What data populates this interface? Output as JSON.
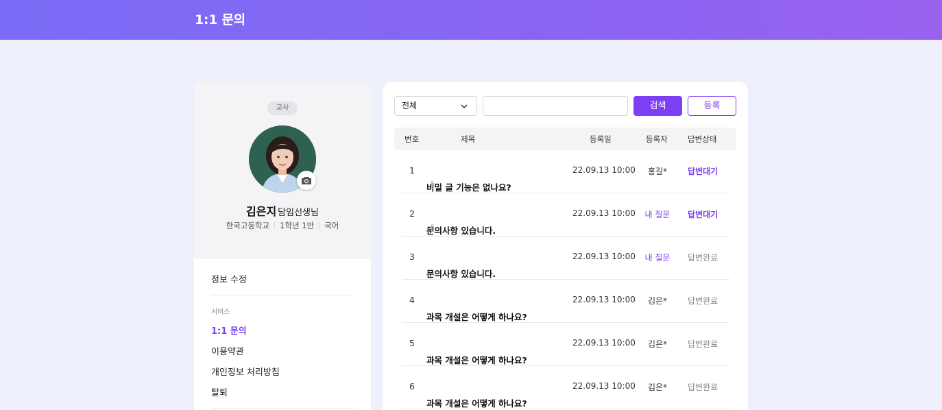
{
  "header": {
    "title": "1:1 문의"
  },
  "profile": {
    "role_badge": "교사",
    "name": "김은지",
    "name_suffix": "담임선생님",
    "school": "한국고등학교",
    "class": "1학년 1반",
    "subject": "국어"
  },
  "menu": {
    "edit_label": "정보 수정",
    "section_label": "서비스",
    "items": [
      {
        "label": "1:1 문의",
        "active": true
      },
      {
        "label": "이용약관",
        "active": false
      },
      {
        "label": "개인정보 처리방침",
        "active": false
      },
      {
        "label": "탈퇴",
        "active": false
      }
    ]
  },
  "toolbar": {
    "filter_value": "전체",
    "search_placeholder": "",
    "search_label": "검색",
    "register_label": "등록"
  },
  "table": {
    "columns": [
      "번호",
      "제목",
      "등록일",
      "등록자",
      "답변상태"
    ],
    "rows": [
      {
        "no": "1",
        "title": "비밀 글 기능은 없나요?",
        "attachment": true,
        "date": "22.09.13 10:00",
        "author": "홍길*",
        "author_mine": false,
        "status": "답변대기",
        "status_pending": true
      },
      {
        "no": "2",
        "title": "문의사항 있습니다.",
        "attachment": true,
        "date": "22.09.13 10:00",
        "author": "내 질문",
        "author_mine": true,
        "status": "답변대기",
        "status_pending": true
      },
      {
        "no": "3",
        "title": "문의사항 있습니다.",
        "attachment": false,
        "date": "22.09.13 10:00",
        "author": "내 질문",
        "author_mine": true,
        "status": "답변완료",
        "status_pending": false
      },
      {
        "no": "4",
        "title": "과목 개설은 어떻게 하나요?",
        "attachment": false,
        "date": "22.09.13 10:00",
        "author": "김은*",
        "author_mine": false,
        "status": "답변완료",
        "status_pending": false
      },
      {
        "no": "5",
        "title": "과목 개설은 어떻게 하나요?",
        "attachment": false,
        "date": "22.09.13 10:00",
        "author": "김은*",
        "author_mine": false,
        "status": "답변완료",
        "status_pending": false
      },
      {
        "no": "6",
        "title": "과목 개설은 어떻게 하나요?",
        "attachment": false,
        "date": "22.09.13 10:00",
        "author": "김은*",
        "author_mine": false,
        "status": "답변완료",
        "status_pending": false
      }
    ]
  },
  "colors": {
    "accent": "#7c3ff3",
    "header_start": "#7a6cf6",
    "header_end": "#9a62ef",
    "background": "#eef0fb"
  },
  "icons": {
    "attachment": "paperclip-icon",
    "camera": "camera-icon",
    "dropdown": "chevron-down-icon"
  }
}
